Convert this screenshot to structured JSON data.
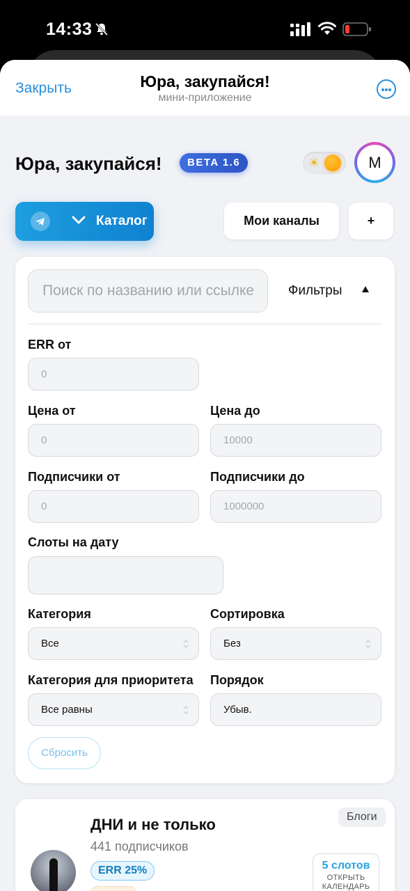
{
  "status_bar": {
    "time": "14:33"
  },
  "telegram": {
    "close_label": "Закрыть",
    "title": "Юра, закупайся!",
    "subtitle": "мини-приложение"
  },
  "app": {
    "title": "Юра, закупайся!",
    "beta": "BETA 1.6",
    "avatar_letter": "M"
  },
  "nav": {
    "catalog_label": "Каталог",
    "my_channels_label": "Мои каналы",
    "add_label": "+"
  },
  "filters": {
    "search_placeholder": "Поиск по названию или ссылке",
    "toggle_label": "Фильтры",
    "err_from": {
      "label": "ERR от",
      "placeholder": "0"
    },
    "price_from": {
      "label": "Цена от",
      "placeholder": "0"
    },
    "price_to": {
      "label": "Цена до",
      "placeholder": "10000"
    },
    "subs_from": {
      "label": "Подписчики от",
      "placeholder": "0"
    },
    "subs_to": {
      "label": "Подписчики до",
      "placeholder": "1000000"
    },
    "slots_date": {
      "label": "Слоты на дату",
      "value": ""
    },
    "category": {
      "label": "Категория",
      "value": "Все"
    },
    "sort": {
      "label": "Сортировка",
      "value": "Без"
    },
    "priority_category": {
      "label": "Категория для приоритета",
      "value": "Все равны"
    },
    "order": {
      "label": "Порядок",
      "value": "Убыв."
    },
    "reset_label": "Сбросить"
  },
  "channel": {
    "name": "ДНИ и не только",
    "subscribers": "441 подписчиков",
    "err": "ERR 25%",
    "category": "Блоги",
    "slots": "5 слотов",
    "calendar_label": "ОТКРЫТЬ КАЛЕНДАРЬ"
  },
  "colors": {
    "accent": "#1e9ee0",
    "link": "#2a8fd8",
    "beta": "#3f6fe0",
    "background": "#f1f2f6"
  }
}
